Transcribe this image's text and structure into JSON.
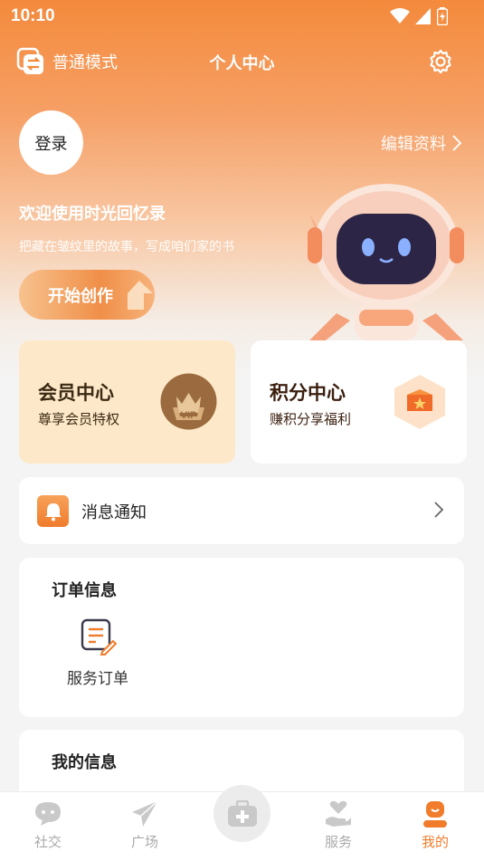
{
  "status_bar": {
    "time": "10:10"
  },
  "header": {
    "mode_label": "普通模式",
    "title": "个人中心"
  },
  "profile": {
    "login_label": "登录",
    "edit_label": "编辑资料",
    "welcome": "欢迎使用时光回忆录",
    "subtitle": "把藏在皱纹里的故事，写成咱们家的书",
    "start_button": "开始创作"
  },
  "vip": {
    "title": "会员中心",
    "subtitle": "尊享会员特权",
    "badge_text": "VIP"
  },
  "points": {
    "title": "积分中心",
    "subtitle": "赚积分享福利"
  },
  "notifications": {
    "label": "消息通知"
  },
  "orders": {
    "title": "订单信息",
    "items": [
      {
        "label": "服务订单",
        "icon": "order-edit-icon"
      }
    ]
  },
  "my_info": {
    "title": "我的信息"
  },
  "tabbar": {
    "items": [
      {
        "label": "社交",
        "icon": "chat-bubble-icon"
      },
      {
        "label": "广场",
        "icon": "paper-plane-icon"
      },
      {
        "label": "",
        "icon": "medical-kit-icon"
      },
      {
        "label": "服务",
        "icon": "heart-hand-icon"
      },
      {
        "label": "我的",
        "icon": "profile-icon"
      }
    ],
    "active": "我的"
  },
  "colors": {
    "accent": "#f07c2c",
    "vip_bg": "#fde9c9",
    "inactive": "#aaaaaa"
  }
}
